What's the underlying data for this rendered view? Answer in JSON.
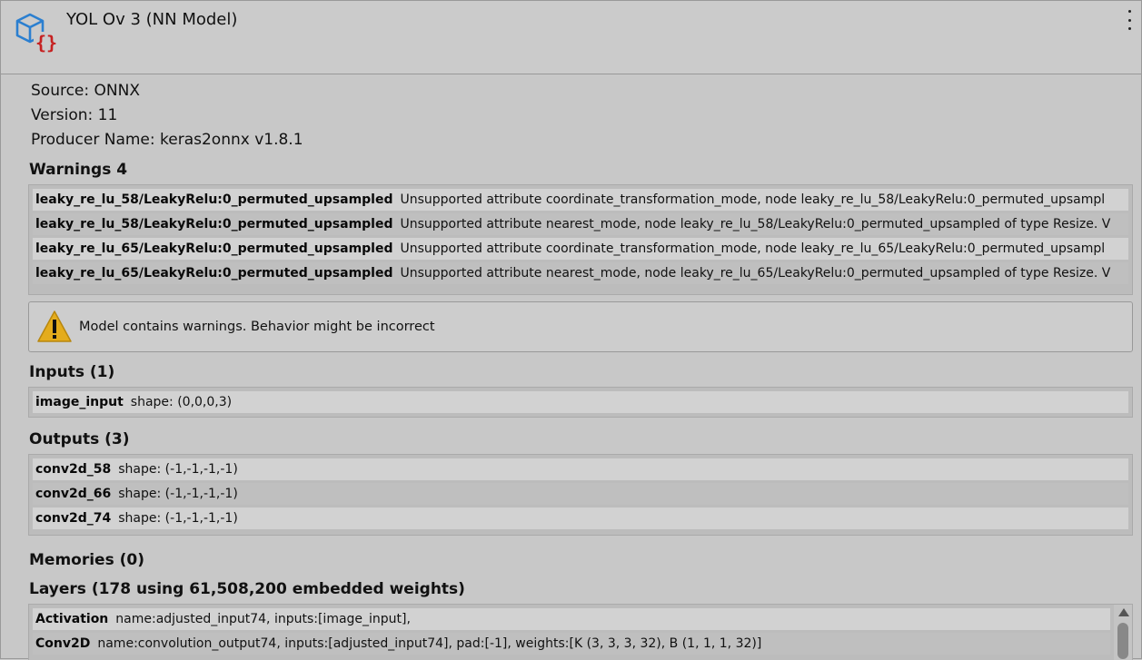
{
  "header": {
    "title": "YOL Ov 3 (NN Model)",
    "icon": "onnx-model-asset-icon",
    "menu_icon": "kebab-menu-icon"
  },
  "info": {
    "source": "Source: ONNX",
    "version": "Version: 11",
    "producer": "Producer Name: keras2onnx v1.8.1"
  },
  "warnings": {
    "title": "Warnings 4",
    "rows": [
      {
        "key": "leaky_re_lu_58/LeakyRelu:0_permuted_upsampled",
        "value": "Unsupported attribute coordinate_transformation_mode, node leaky_re_lu_58/LeakyRelu:0_permuted_upsampl"
      },
      {
        "key": "leaky_re_lu_58/LeakyRelu:0_permuted_upsampled",
        "value": "Unsupported attribute nearest_mode, node leaky_re_lu_58/LeakyRelu:0_permuted_upsampled of type Resize. V"
      },
      {
        "key": "leaky_re_lu_65/LeakyRelu:0_permuted_upsampled",
        "value": "Unsupported attribute coordinate_transformation_mode, node leaky_re_lu_65/LeakyRelu:0_permuted_upsampl"
      },
      {
        "key": "leaky_re_lu_65/LeakyRelu:0_permuted_upsampled",
        "value": "Unsupported attribute nearest_mode, node leaky_re_lu_65/LeakyRelu:0_permuted_upsampled of type Resize. V"
      }
    ]
  },
  "helpbox": {
    "icon": "warning-triangle-icon",
    "message": "Model contains warnings. Behavior might be incorrect"
  },
  "inputs": {
    "title": "Inputs (1)",
    "rows": [
      {
        "key": "image_input",
        "value": "shape: (0,0,0,3)"
      }
    ]
  },
  "outputs": {
    "title": "Outputs (3)",
    "rows": [
      {
        "key": "conv2d_58",
        "value": "shape: (-1,-1,-1,-1)"
      },
      {
        "key": "conv2d_66",
        "value": "shape: (-1,-1,-1,-1)"
      },
      {
        "key": "conv2d_74",
        "value": "shape: (-1,-1,-1,-1)"
      }
    ]
  },
  "memories": {
    "title": "Memories (0)"
  },
  "layers": {
    "title": "Layers (178 using 61,508,200 embedded weights)",
    "rows": [
      {
        "key": "Activation",
        "value": "name:adjusted_input74, inputs:[image_input],"
      },
      {
        "key": "Conv2D",
        "value": "name:convolution_output74, inputs:[adjusted_input74], pad:[-1], weights:[K (3, 3, 3, 32), B (1, 1, 1, 32)]"
      }
    ]
  },
  "colors": {
    "icon_blue": "#2b7fd0",
    "icon_red": "#c62020",
    "warning_yellow": "#e4ac1c"
  }
}
